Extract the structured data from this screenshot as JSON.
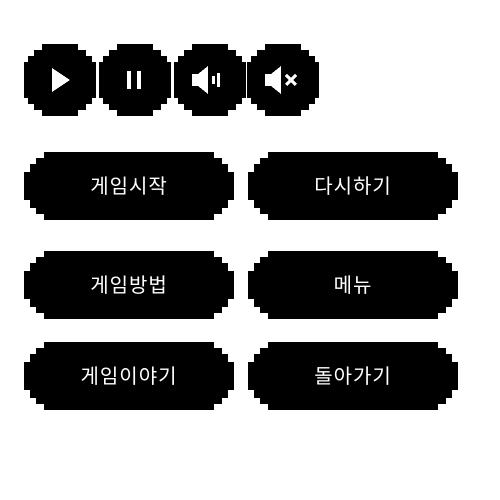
{
  "colors": {
    "button_fill": "#000000",
    "label_text": "#ffffff",
    "background": "#ffffff"
  },
  "icon_buttons": [
    {
      "name": "play-icon"
    },
    {
      "name": "pause-icon"
    },
    {
      "name": "sound-on-icon"
    },
    {
      "name": "sound-mute-icon"
    }
  ],
  "menu": {
    "start_game": "게임시작",
    "restart": "다시하기",
    "how_to_play": "게임방법",
    "main_menu": "메뉴",
    "game_story": "게임이야기",
    "go_back": "돌아가기"
  }
}
